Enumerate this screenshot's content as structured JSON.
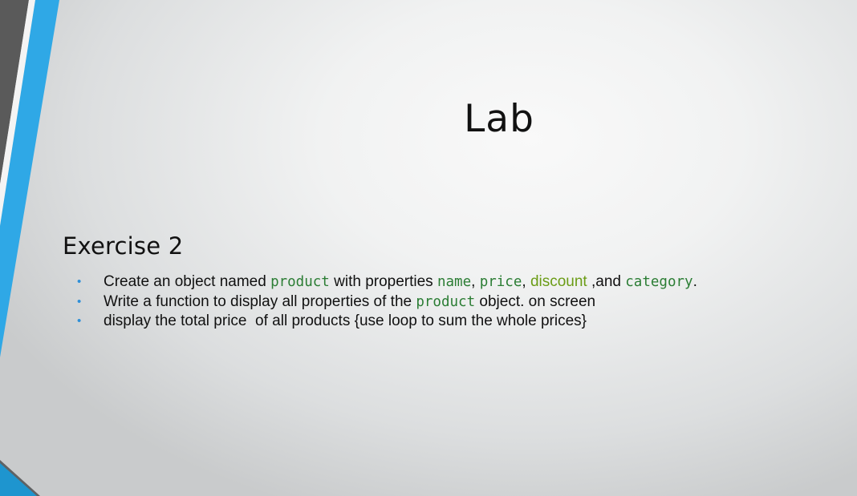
{
  "slide": {
    "title": "Lab",
    "subtitle": "Exercise 2",
    "bullet_marker": "•",
    "bullets": [
      {
        "parts": [
          "Create an object named ",
          "product",
          " with properties ",
          "name",
          ", ",
          "price",
          ", ",
          "discount",
          " ,and ",
          "category",
          "."
        ]
      },
      {
        "parts": [
          "Write a function to display all properties of the ",
          "product",
          " object. on screen"
        ]
      },
      {
        "parts": [
          "display the total price  of all products {use loop to sum the whole prices}"
        ]
      }
    ]
  },
  "colors": {
    "accent_blue": "#2fa8e6",
    "accent_gray": "#5a5a5a",
    "code_green": "#2b7d34",
    "highlight_green": "#6b9c16",
    "bullet_blue": "#2f8fd8"
  }
}
